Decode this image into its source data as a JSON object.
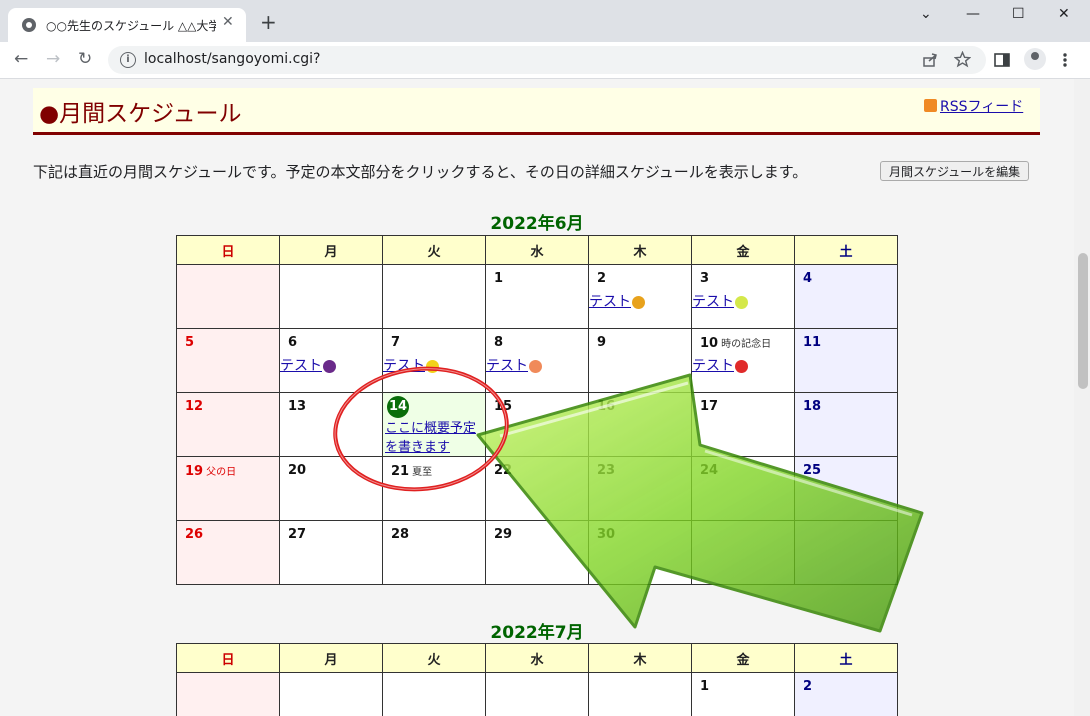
{
  "browser": {
    "tab_title": "○○先生のスケジュール △△大学☆",
    "tab_close": "✕",
    "new_tab": "+",
    "url": "localhost/sangoyomi.cgi?",
    "window_controls": {
      "chevron": "⌄",
      "minimize": "—",
      "maximize": "☐",
      "close": "✕"
    },
    "nav": {
      "back": "←",
      "forward": "→",
      "reload": "↻"
    },
    "toolbar_icons": [
      "share-icon",
      "star-icon",
      "sidebar-icon",
      "profile-icon",
      "menu-icon"
    ]
  },
  "page": {
    "title": "●月間スケジュール",
    "rss_label": "RSSフィード",
    "description": "下記は直近の月間スケジュールです。予定の本文部分をクリックすると、その日の詳細スケジュールを表示します。",
    "edit_button": "月間スケジュールを編集"
  },
  "weekdays": [
    "日",
    "月",
    "火",
    "水",
    "木",
    "金",
    "土"
  ],
  "calendars": [
    {
      "title": "2022年6月",
      "weeks": [
        [
          {},
          {},
          {},
          {
            "day": "1"
          },
          {
            "day": "2",
            "event": "テスト",
            "fruit": "pineapple"
          },
          {
            "day": "3",
            "event": "テスト",
            "fruit": "lime"
          },
          {
            "day": "4"
          }
        ],
        [
          {
            "day": "5"
          },
          {
            "day": "6",
            "event": "テスト",
            "fruit": "grape"
          },
          {
            "day": "7",
            "event": "テスト",
            "fruit": "lemon"
          },
          {
            "day": "8",
            "event": "テスト",
            "fruit": "peach"
          },
          {
            "day": "9"
          },
          {
            "day": "10",
            "note": "時の記念日",
            "event": "テスト",
            "fruit": "strawberry"
          },
          {
            "day": "11"
          }
        ],
        [
          {
            "day": "12"
          },
          {
            "day": "13"
          },
          {
            "day": "14",
            "today": true,
            "event": "ここに概要予定を書きます"
          },
          {
            "day": "15"
          },
          {
            "day": "16"
          },
          {
            "day": "17"
          },
          {
            "day": "18"
          }
        ],
        [
          {
            "day": "19",
            "note": "父の日"
          },
          {
            "day": "20"
          },
          {
            "day": "21",
            "note": "夏至"
          },
          {
            "day": "22"
          },
          {
            "day": "23"
          },
          {
            "day": "24"
          },
          {
            "day": "25"
          }
        ],
        [
          {
            "day": "26"
          },
          {
            "day": "27"
          },
          {
            "day": "28"
          },
          {
            "day": "29"
          },
          {
            "day": "30"
          },
          {},
          {}
        ]
      ]
    },
    {
      "title": "2022年7月",
      "weeks": [
        [
          {},
          {},
          {},
          {},
          {},
          {
            "day": "1"
          },
          {
            "day": "2"
          }
        ]
      ]
    }
  ],
  "colors": {
    "title": "#800000",
    "header_bg": "#ffffe6",
    "month_title": "#006400",
    "sunday": "#dd0000",
    "saturday": "#000080",
    "today_circle": "#0a6e0a",
    "annotation_arrow": "#7ed321",
    "annotation_ring": "#e02020"
  }
}
